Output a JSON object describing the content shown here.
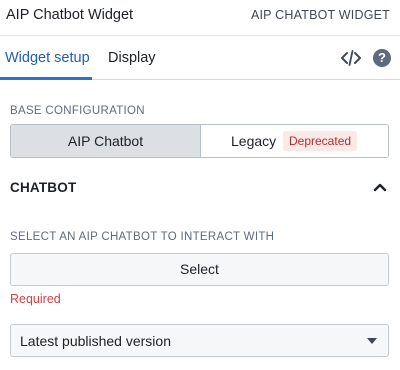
{
  "header": {
    "title": "AIP Chatbot Widget",
    "widget_type": "AIP CHATBOT WIDGET"
  },
  "tabs": [
    {
      "label": "Widget setup",
      "active": true
    },
    {
      "label": "Display",
      "active": false
    }
  ],
  "toolbar_icons": [
    "code-icon",
    "help-icon"
  ],
  "help_glyph": "?",
  "base_configuration": {
    "label": "BASE CONFIGURATION",
    "options": [
      {
        "label": "AIP Chatbot",
        "selected": true
      },
      {
        "label": "Legacy",
        "selected": false,
        "badge": "Deprecated"
      }
    ]
  },
  "chatbot_section": {
    "title": "CHATBOT",
    "expanded": true,
    "select_label": "SELECT AN AIP CHATBOT TO INTERACT WITH",
    "select_button": "Select",
    "validation": "Required",
    "version_dropdown": {
      "value": "Latest published version"
    }
  },
  "colors": {
    "accent": "#2d72d2",
    "active_tab_text": "#215db0",
    "error": "#cd4246",
    "badge_bg": "#fbe9e7",
    "badge_text": "#ac2f33",
    "selected_segment": "#dce0e5"
  }
}
